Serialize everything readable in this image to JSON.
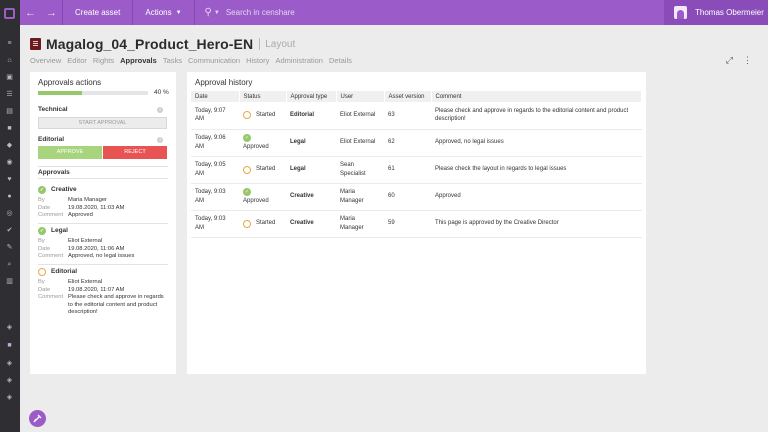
{
  "topbar": {
    "create_label": "Create asset",
    "actions_label": "Actions",
    "search_placeholder": "Search in censhare",
    "user_name": "Thomas Obermeier"
  },
  "asset": {
    "name": "Magalog_04_Product_Hero-EN",
    "type": "Layout"
  },
  "tabs": [
    {
      "label": "Overview"
    },
    {
      "label": "Editor"
    },
    {
      "label": "Rights"
    },
    {
      "label": "Approvals",
      "active": true
    },
    {
      "label": "Tasks"
    },
    {
      "label": "Communication"
    },
    {
      "label": "History"
    },
    {
      "label": "Administration"
    },
    {
      "label": "Details"
    }
  ],
  "approvals_actions": {
    "title": "Approvals actions",
    "progress": 40,
    "progress_text": "40 %",
    "technical_label": "Technical",
    "start_button": "START APPROVAL",
    "editorial_label": "Editorial",
    "approve_button": "APPROVE",
    "reject_button": "REJECT",
    "approvals_label": "Approvals",
    "items": [
      {
        "name": "Creative",
        "status": "approved",
        "by_label": "By",
        "by": "Maria Manager",
        "date_label": "Date",
        "date": "19.08.2020, 11:03 AM",
        "comment_label": "Comment",
        "comment": "Approved"
      },
      {
        "name": "Legal",
        "status": "approved",
        "by_label": "By",
        "by": "Eliot External",
        "date_label": "Date",
        "date": "19.08.2020, 11:06 AM",
        "comment_label": "Comment",
        "comment": "Approved, no legal issues"
      },
      {
        "name": "Editorial",
        "status": "pending",
        "by_label": "By",
        "by": "Eliot External",
        "date_label": "Date",
        "date": "19.08.2020, 11:07 AM",
        "comment_label": "Comment",
        "comment": "Please check and approve in regards to the editorial content and product description!"
      }
    ]
  },
  "history": {
    "title": "Approval history",
    "columns": [
      "Date",
      "Status",
      "Approval type",
      "User",
      "Asset version",
      "Comment"
    ],
    "rows": [
      {
        "date": "Today, 9:07 AM",
        "status": "Started",
        "status_kind": "pending",
        "type": "Editorial",
        "user": "Eliot External",
        "version": "63",
        "comment": "Please check and approve in regards to the editorial content and product description!"
      },
      {
        "date": "Today, 9:06 AM",
        "status": "Approved",
        "status_kind": "approved",
        "type": "Legal",
        "user": "Eliot External",
        "version": "62",
        "comment": "Approved, no legal issues"
      },
      {
        "date": "Today, 9:05 AM",
        "status": "Started",
        "status_kind": "pending",
        "type": "Legal",
        "user": "Sean Specialist",
        "version": "61",
        "comment": "Please check the layout in regards to legal issues"
      },
      {
        "date": "Today, 9:03 AM",
        "status": "Approved",
        "status_kind": "approved",
        "type": "Creative",
        "user": "Maria Manager",
        "version": "60",
        "comment": "Approved"
      },
      {
        "date": "Today, 9:03 AM",
        "status": "Started",
        "status_kind": "pending",
        "type": "Creative",
        "user": "Maria Manager",
        "version": "59",
        "comment": "This page is approved by the Creative Director"
      }
    ]
  },
  "colors": {
    "brand": "#9b5cc9",
    "approve": "#a8d47e",
    "reject": "#e85454",
    "pending": "#e8a845"
  },
  "icons": [
    "back-arrow-icon",
    "forward-arrow-icon",
    "search-icon",
    "expand-icon",
    "more-vertical-icon",
    "document-icon",
    "avatar-icon",
    "check-icon",
    "pending-circle-icon",
    "pin-icon"
  ]
}
